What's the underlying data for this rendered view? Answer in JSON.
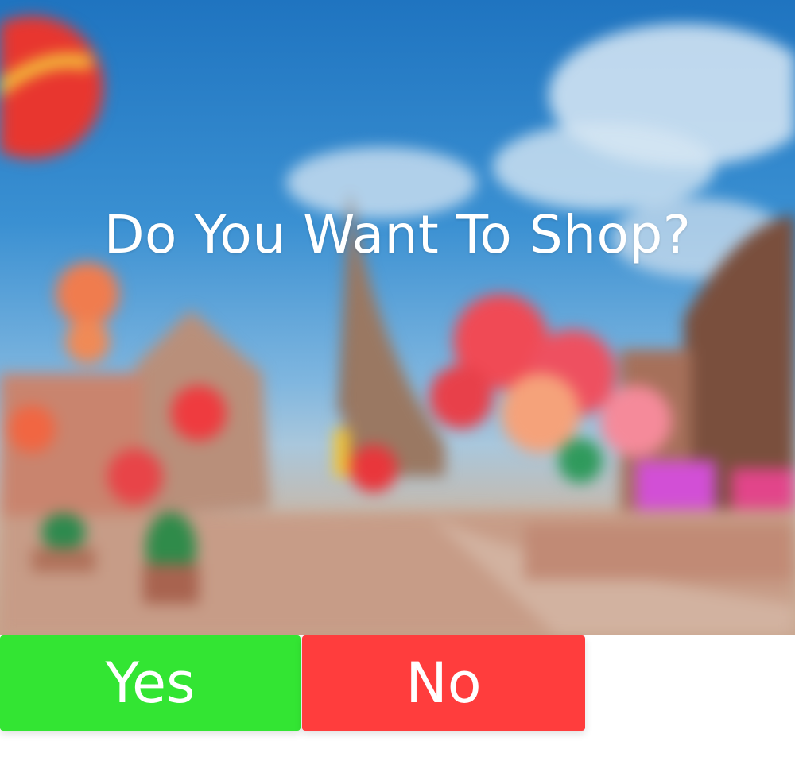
{
  "dialog": {
    "prompt": "Do You Want To Shop?",
    "yes_label": "Yes",
    "no_label": "No"
  },
  "colors": {
    "yes_button": "#33e533",
    "no_button": "#ff3d3d",
    "prompt_text": "#ffffff"
  }
}
